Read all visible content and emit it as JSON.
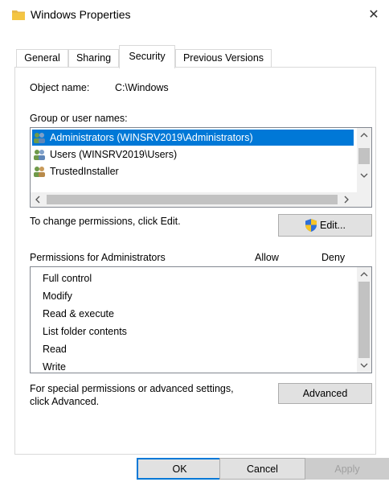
{
  "window": {
    "title": "Windows Properties",
    "close_glyph": "✕"
  },
  "tabs": [
    {
      "label": "General",
      "active": false
    },
    {
      "label": "Sharing",
      "active": false
    },
    {
      "label": "Security",
      "active": true
    },
    {
      "label": "Previous Versions",
      "active": false
    }
  ],
  "security": {
    "object_name_label": "Object name:",
    "object_name_value": "C:\\Windows",
    "group_label": "Group or user names:",
    "users": [
      {
        "name": "Administrators (WINSRV2019\\Administrators)",
        "selected": true,
        "icon": "users-group-icon"
      },
      {
        "name": "Users (WINSRV2019\\Users)",
        "selected": false,
        "icon": "users-group-icon"
      },
      {
        "name": "TrustedInstaller",
        "selected": false,
        "icon": "users-group-icon"
      }
    ],
    "change_permissions_text": "To change permissions, click Edit.",
    "edit_button": "Edit...",
    "permissions_label": "Permissions for Administrators",
    "allow_header": "Allow",
    "deny_header": "Deny",
    "permissions": [
      "Full control",
      "Modify",
      "Read & execute",
      "List folder contents",
      "Read",
      "Write"
    ],
    "advanced_text_line1": "For special permissions or advanced settings,",
    "advanced_text_line2": "click Advanced.",
    "advanced_button": "Advanced"
  },
  "footer": {
    "ok": "OK",
    "cancel": "Cancel",
    "apply": "Apply"
  },
  "colors": {
    "selection": "#0078d7",
    "folder": "#f4c542",
    "shield_blue": "#2f6fd8",
    "shield_yellow": "#f7c526"
  }
}
